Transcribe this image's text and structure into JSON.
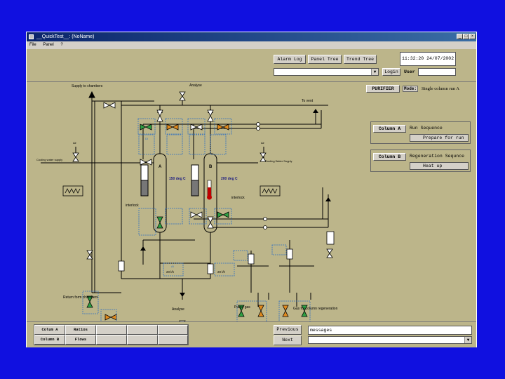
{
  "window": {
    "title": "__QuickTest__: (NoName)"
  },
  "menu": [
    "File",
    "Panel",
    "?"
  ],
  "toolbar": {
    "alarm_log": "Alarm Log",
    "panel_tree": "Panel Tree",
    "trend_tree": "Trend Tree",
    "clock": "11:32:20  24/07/2002",
    "login_label": "Login",
    "user_label": "User"
  },
  "status": {
    "purifier_button": "PURIFIER",
    "mode_label": "Mode:",
    "mode_value": "Single column run A"
  },
  "column_a": {
    "button": "Column A",
    "sequence_label": "Run Sequence",
    "sequence_state": "Prepare for run"
  },
  "column_b": {
    "button": "Column B",
    "sequence_label": "Regeneration Sequnce",
    "sequence_state": "Heat up"
  },
  "diagram": {
    "supply_to_chambers": "Supply to chambers",
    "analyse_top": "Analyse",
    "to_vent": "To vent",
    "air_left": "Air",
    "air_right": "Air",
    "cooling_water_left": "Cooling water supply",
    "cooling_water_right": "Cooling Water Supply",
    "column_a_letter": "A",
    "column_b_letter": "B",
    "temp_a": "150 deg C",
    "temp_b": "200 deg C",
    "interlock_left": "interlock",
    "interlock_right": "interlock",
    "return_from_chambers": "Return form chambers",
    "analyse_bottom": "Analyse",
    "purge_gas": "Purge gas",
    "gas_regen": "Gas for column regeneration",
    "flow_a": "20 l/h",
    "flow_b": "20 l/h",
    "di": "DI",
    "ai": "AI"
  },
  "bottom": {
    "table": [
      [
        "Colum A",
        "Ratios"
      ],
      [
        "Column B",
        "Flows"
      ]
    ],
    "previous": "Previous",
    "next": "Next",
    "messages": "messages"
  },
  "colors": {
    "desktop": "#1010e0",
    "panel": "#bcb58a",
    "valve_green": "#2ea043",
    "valve_orange": "#e08a1e",
    "di_box_border": "#3070c0"
  }
}
